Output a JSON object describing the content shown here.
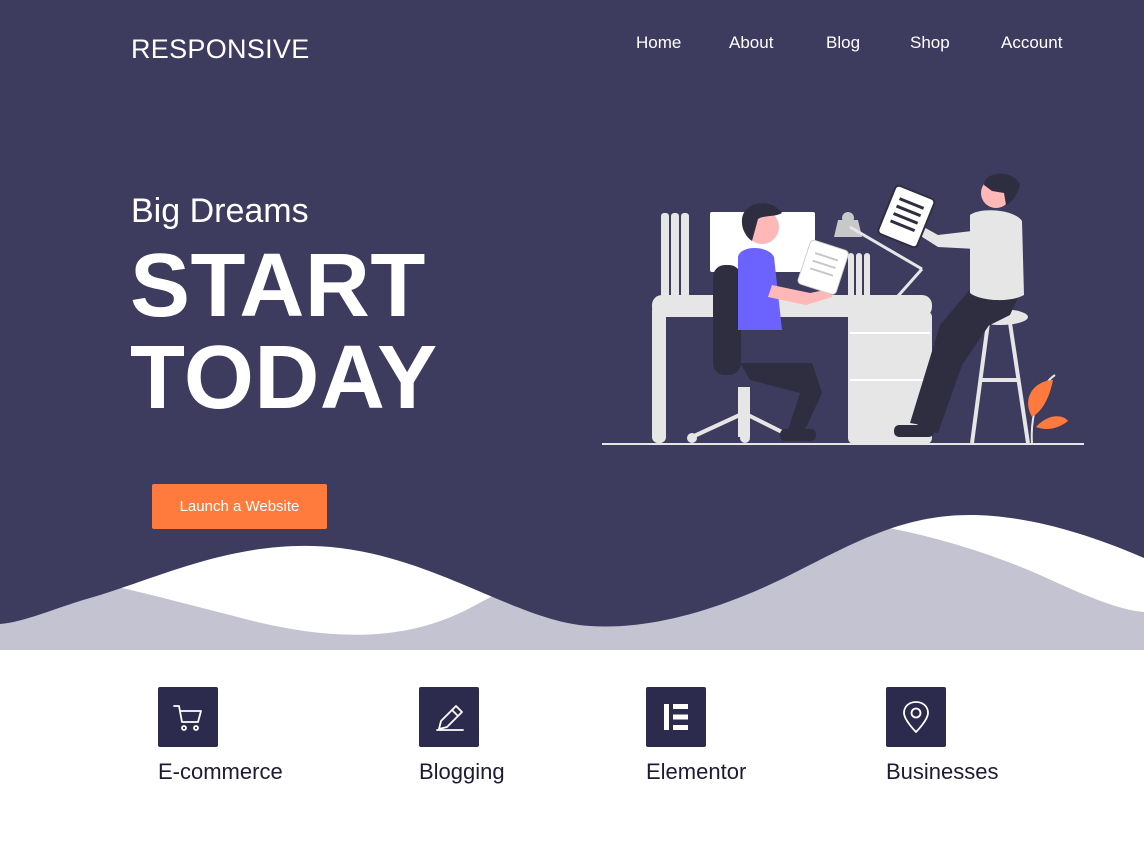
{
  "site": {
    "logo": "RESPONSIVE"
  },
  "nav": {
    "items": [
      "Home",
      "About",
      "Blog",
      "Shop",
      "Account"
    ]
  },
  "hero": {
    "tagline": "Big Dreams",
    "headline_line1": "START",
    "headline_line2": "TODAY",
    "cta_label": "Launch a Website"
  },
  "features": [
    {
      "label": "E-commerce",
      "icon": "shopping-cart-icon"
    },
    {
      "label": "Blogging",
      "icon": "pencil-icon"
    },
    {
      "label": "Elementor",
      "icon": "elementor-icon"
    },
    {
      "label": "Businesses",
      "icon": "map-pin-icon"
    }
  ],
  "colors": {
    "hero_background": "#3d3b5e",
    "accent": "#ff7a3d",
    "icon_box": "#2d2b4d",
    "wave_light": "#c4c3d1"
  }
}
